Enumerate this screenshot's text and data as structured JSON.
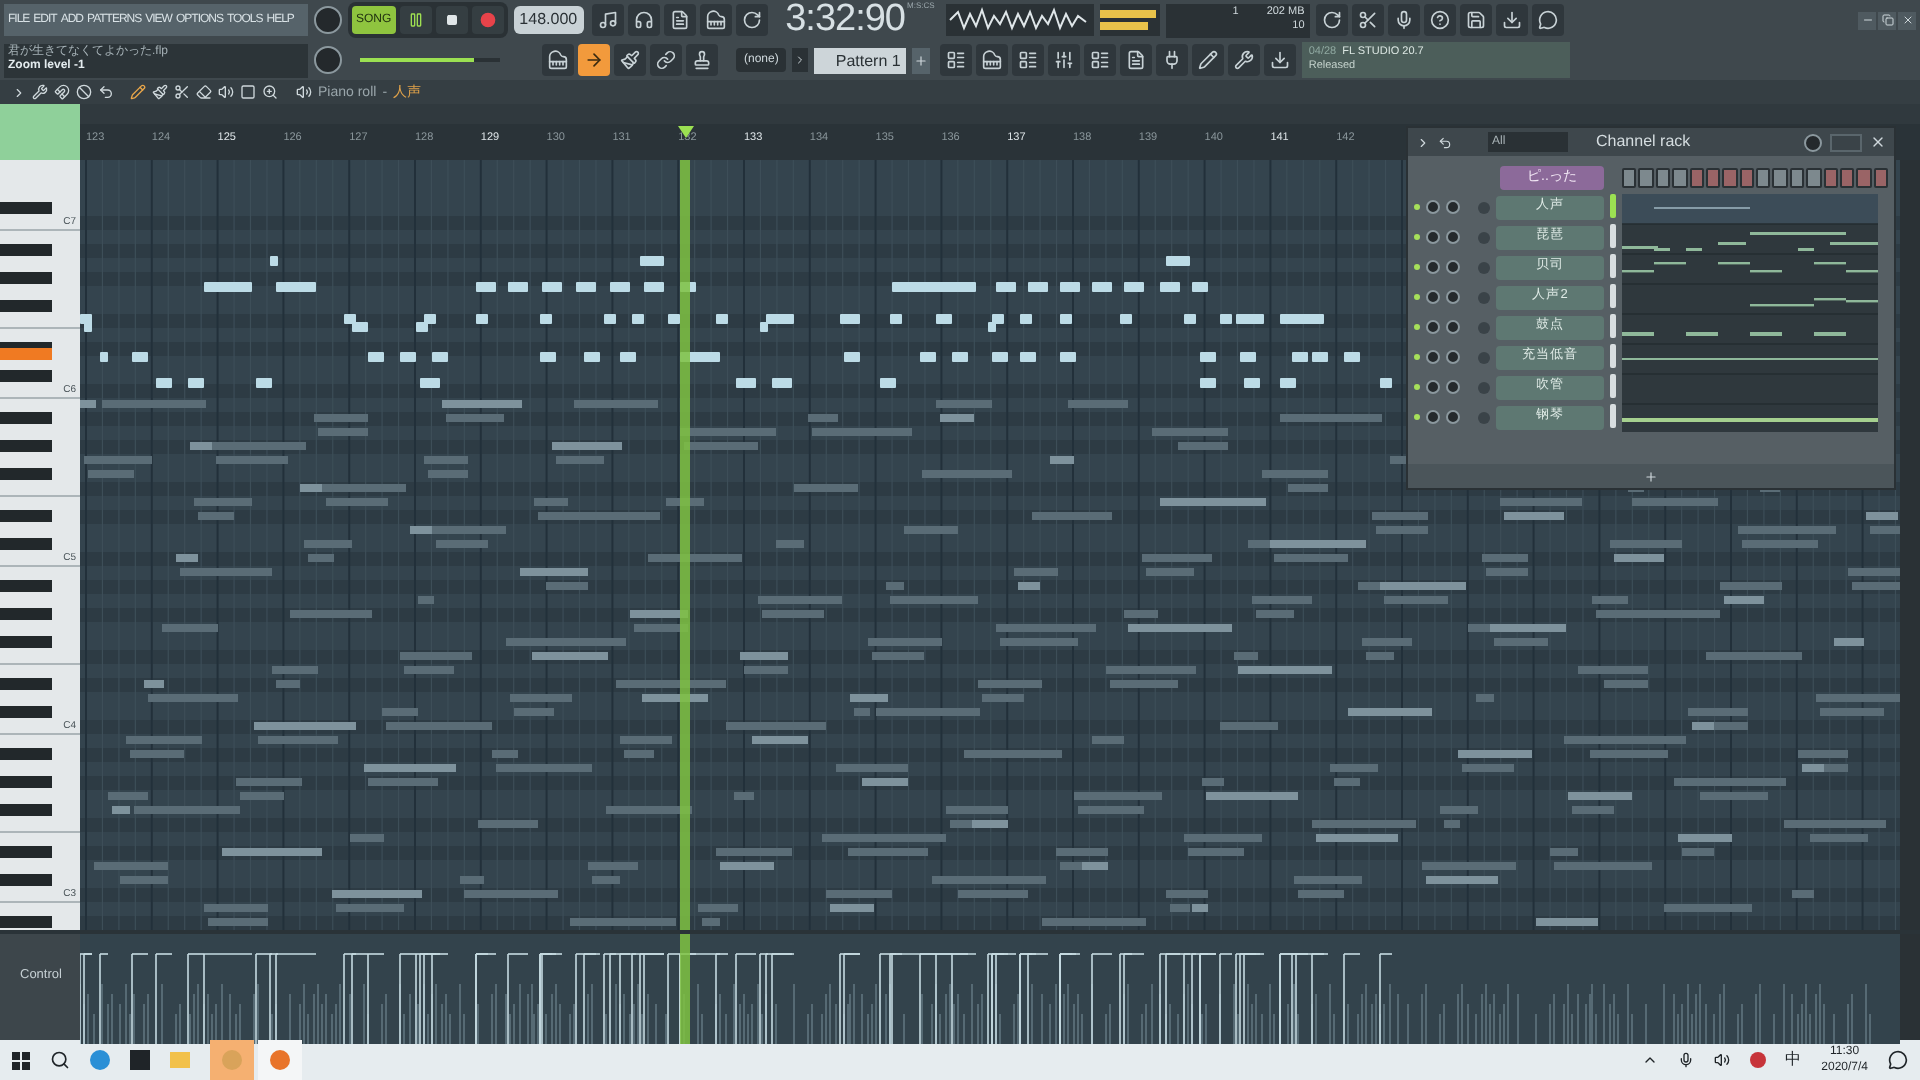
{
  "menu": [
    "FILE",
    "EDIT",
    "ADD",
    "PATTERNS",
    "VIEW",
    "OPTIONS",
    "TOOLS",
    "HELP"
  ],
  "hint": {
    "file": "君が生きてなくてよかった.flp",
    "message": "Zoom level -1"
  },
  "transport": {
    "mode": "SONG",
    "song_mode": true,
    "playing": true,
    "tempo": "148.000",
    "time": "3:32:90",
    "time_unit": "M:S:CS"
  },
  "master_volume": {
    "level": 0.82
  },
  "system": {
    "cpu": "1",
    "memory": "202 MB",
    "voices": "10"
  },
  "tool_buttons": [
    {
      "kind": "piano",
      "selected": false
    },
    {
      "kind": "arrow",
      "selected": true
    },
    {
      "kind": "brush",
      "selected": false
    },
    {
      "kind": "link",
      "selected": false
    },
    {
      "kind": "stamp",
      "selected": false
    }
  ],
  "pattern": {
    "preset": "(none)",
    "name": "Pattern 1"
  },
  "news": {
    "date": "04/28",
    "title": "FL STUDIO 20.7",
    "status": "Released"
  },
  "piano_roll": {
    "title": "Piano roll",
    "separator": "-",
    "instrument": "人声",
    "bars": [
      "123",
      "124",
      "125",
      "126",
      "127",
      "128",
      "129",
      "130",
      "131",
      "132",
      "133",
      "134",
      "135",
      "136",
      "137",
      "138",
      "139",
      "140",
      "141",
      "142"
    ],
    "keys": [
      "C7",
      "C6",
      "C5",
      "C4",
      "C3"
    ],
    "control_label": "Control"
  },
  "channel_rack": {
    "title": "Channel rack",
    "filter": "All",
    "header": "ピ..った",
    "channels": [
      {
        "name": "人声",
        "selected": true
      },
      {
        "name": "琵琶",
        "selected": false
      },
      {
        "name": "贝司",
        "selected": false
      },
      {
        "name": "人声2",
        "selected": false
      },
      {
        "name": "鼓点",
        "selected": false
      },
      {
        "name": "充当低音",
        "selected": false
      },
      {
        "name": "吹管",
        "selected": false
      },
      {
        "name": "钢琴",
        "selected": false
      }
    ]
  },
  "taskbar": {
    "ime": "中",
    "time": "11:30",
    "date": "2020/7/4"
  }
}
